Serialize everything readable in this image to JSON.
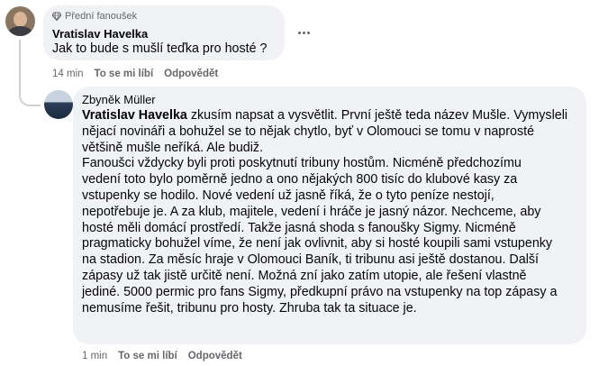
{
  "comment1": {
    "badge": "Přední fanoušek",
    "author": "Vratislav Havelka",
    "text": "Jak to bude s mušlí teďka pro hosté ?",
    "time": "14 min",
    "like_label": "To se mi líbí",
    "reply_label": "Odpovědět"
  },
  "comment2": {
    "author": "Zbyněk Müller",
    "mention": "Vratislav Havelka",
    "lines": [
      " zkusím napsat a vysvětlit. První ještě teda název Mušle. Vymysleli",
      "nějací novináři a bohužel se to nějak chytlo, byť v Olomouci se tomu v naprosté",
      "většině mušle neříká. Ale budiž.",
      "Fanoušci vždycky byli proti poskytnutí tribuny hostům. Nicméně předchozímu",
      "vedení toto bylo poměrně jedno a ono nějakých 800 tisíc do klubové kasy za",
      "vstupenky se hodilo. Nové vedení už jasně říká, že o tyto peníze nestojí,",
      "nepotřebuje je. A za klub, majitele, vedení i hráče je jasný názor. Nechceme, aby",
      "hosté měli domácí prostředí. Takže jasná shoda s fanoušky Sigmy. Nicméně",
      "pragmaticky bohužel víme, že není jak ovlivnit, aby si hosté koupili sami vstupenky",
      "na stadion. Za měsíc hraje v Olomouci Baník, ti tribunu asi ještě dostanou. Další",
      "zápasy už tak jistě určitě není. Možná zní jako zatím utopie, ale řešení vlastně",
      "jediné. 5000 permic pro fans Sigmy, předkupní právo na vstupenky na top zápasy a",
      "nemusíme řešit, tribunu pro hosty. Zhruba tak ta situace je."
    ],
    "time": "1 min",
    "like_label": "To se mi líbí",
    "reply_label": "Odpovědět"
  },
  "icons": {
    "badge": "diamond-icon",
    "more": "more-options-icon"
  },
  "colors": {
    "bubble": "#f0f2f5",
    "secondary_text": "#65676b",
    "primary_text": "#050505"
  }
}
